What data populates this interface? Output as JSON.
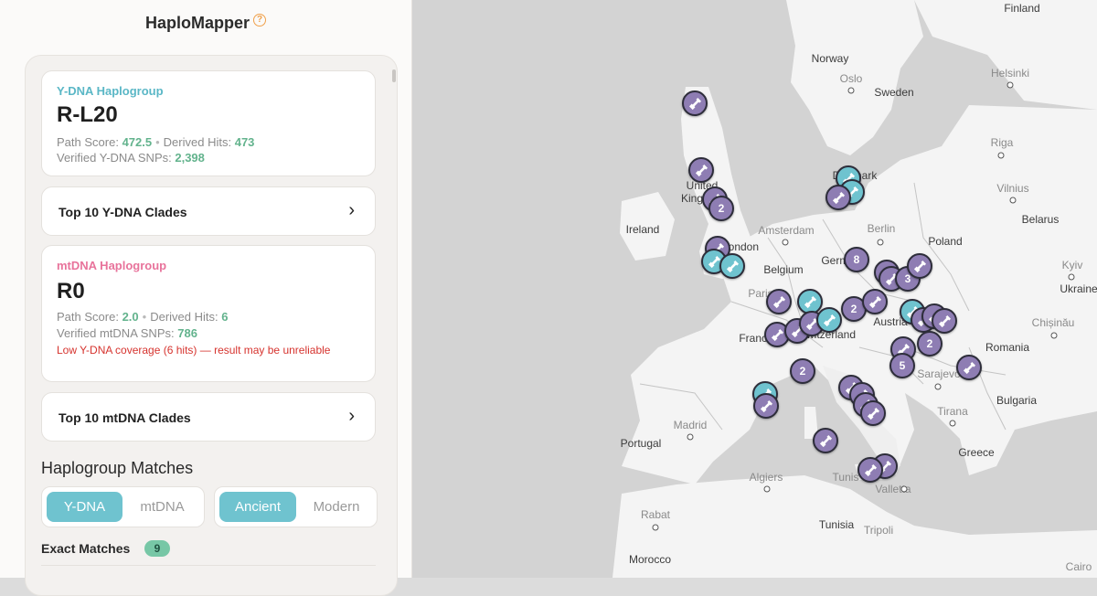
{
  "app": {
    "title": "HaploMapper",
    "help_icon": "help-circle-icon"
  },
  "ydna": {
    "kicker": "Y-DNA Haplogroup",
    "haplogroup": "R-L20",
    "path_score_label": "Path Score:",
    "path_score": "472.5",
    "derived_hits_label": "Derived Hits:",
    "derived_hits": "473",
    "verified_label": "Verified Y-DNA SNPs:",
    "verified": "2,398",
    "kicker_color": "#5ab7c6"
  },
  "top_ydna": {
    "label": "Top 10 Y-DNA Clades",
    "chevron": "›"
  },
  "mtdna": {
    "kicker": "mtDNA Haplogroup",
    "haplogroup": "R0",
    "path_score_label": "Path Score:",
    "path_score": "2.0",
    "derived_hits_label": "Derived Hits:",
    "derived_hits": "6",
    "verified_label": "Verified mtDNA SNPs:",
    "verified": "786",
    "warning": "Low Y-DNA coverage (6 hits) — result may be unreliable",
    "kicker_color": "#e8739b"
  },
  "top_mtdna": {
    "label": "Top 10 mtDNA Clades",
    "chevron": "›"
  },
  "matches": {
    "heading": "Haplogroup Matches",
    "dna_toggle": [
      "Y-DNA",
      "mtDNA"
    ],
    "dna_selected": "Y-DNA",
    "era_toggle": [
      "Ancient",
      "Modern"
    ],
    "era_selected": "Ancient",
    "exact_label": "Exact Matches",
    "exact_count": "9"
  },
  "map": {
    "labels": [
      "Finland",
      "Norway",
      "Oslo",
      "Sweden",
      "Helsinki",
      "Riga",
      "Vilnius",
      "Belarus",
      "Ireland",
      "United Kingdom",
      "Denmark",
      "Amsterdam",
      "Berlin",
      "Poland",
      "Kyiv",
      "Ukraine",
      "Belgium",
      "Germany",
      "Paris",
      "France",
      "Austria",
      "Chișinău",
      "Switzerland",
      "Romania",
      "Sarajevo",
      "Bulgaria",
      "Tirana",
      "Madrid",
      "Portugal",
      "Greece",
      "Algiers",
      "Tunis",
      "Valletta",
      "Rabat",
      "Tunisia",
      "Tripoli",
      "Morocco",
      "Cairo",
      "London"
    ],
    "cluster_counts": [
      "2",
      "8",
      "3",
      "2",
      "2",
      "5",
      "2"
    ]
  }
}
